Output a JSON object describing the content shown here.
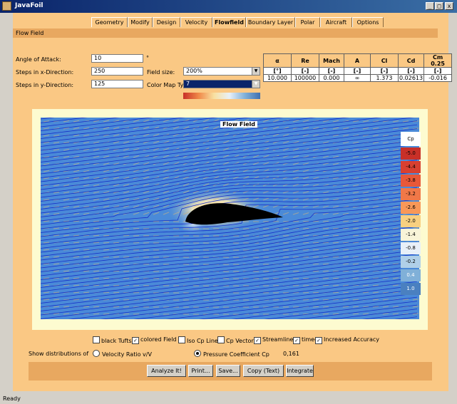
{
  "window": {
    "title": "JavaFoil",
    "btn_min": "_",
    "btn_max": "□",
    "btn_close": "x"
  },
  "tabs": [
    "Geometry",
    "Modify",
    "Design",
    "Velocity",
    "Flowfield",
    "Boundary Layer",
    "Polar",
    "Aircraft",
    "Options"
  ],
  "active_tab": "Flowfield",
  "section_title": "Flow Field",
  "form": {
    "aoa_label": "Angle of Attack:",
    "aoa_value": "10",
    "aoa_unit": "°",
    "stepsx_label": "Steps in x-Direction:",
    "stepsx_value": "250",
    "stepsy_label": "Steps in y-Direction:",
    "stepsy_value": "125",
    "fieldsize_label": "Field size:",
    "fieldsize_value": "200%",
    "cmap_label": "Color Map Type:",
    "cmap_value": "7"
  },
  "results": {
    "headers": [
      "α",
      "Re",
      "Mach",
      "A",
      "Cl",
      "Cd",
      "Cm 0.25"
    ],
    "units": [
      "[°]",
      "[-]",
      "[-]",
      "[-]",
      "[-]",
      "[-]",
      "[-]"
    ],
    "values": [
      "10.000",
      "100000",
      "0.000",
      "∞",
      "1.373",
      "0.02613",
      "-0.016"
    ]
  },
  "plot": {
    "title": "Flow Field"
  },
  "legend": {
    "title": "Cp",
    "entries": [
      {
        "label": "-5.0",
        "color": "#c83028"
      },
      {
        "label": "-4.4",
        "color": "#d84030"
      },
      {
        "label": "-3.8",
        "color": "#e85838"
      },
      {
        "label": "-3.2",
        "color": "#f07848"
      },
      {
        "label": "-2.6",
        "color": "#f89858"
      },
      {
        "label": "-2.0",
        "color": "#f8d080"
      },
      {
        "label": "-1.4",
        "color": "#f8f4d8"
      },
      {
        "label": "-0.8",
        "color": "#e8f0f8"
      },
      {
        "label": "-0.2",
        "color": "#b0d0e8"
      },
      {
        "label": "0.4",
        "color": "#80b0d8"
      },
      {
        "label": "1.0",
        "color": "#4a80c0"
      }
    ]
  },
  "options": {
    "black_tufts": {
      "label": "black Tufts",
      "checked": false
    },
    "colored_field": {
      "label": "colored Field",
      "checked": true
    },
    "iso_cp": {
      "label": "Iso Cp Lines",
      "checked": false
    },
    "cp_vectors": {
      "label": "Cp Vectors",
      "checked": false
    },
    "streamlines": {
      "label": "Streamlines",
      "checked": true
    },
    "timed": {
      "label": "timed",
      "checked": true
    },
    "accuracy": {
      "label": "Increased Accuracy",
      "checked": true
    }
  },
  "distributions": {
    "label": "Show distributions of",
    "velocity_ratio": "Velocity Ratio v/V",
    "pressure_coeff": "Pressure Coefficient Cp",
    "value": "0,161"
  },
  "buttons": [
    "Analyze It!",
    "Print...",
    "Save...",
    "Copy (Text)",
    "Integrate"
  ],
  "status": "Ready",
  "colors": {
    "panel": "#fac884",
    "section": "#e8a860",
    "field_bg": "#4a8ad8",
    "streamline": "#1830c8"
  }
}
